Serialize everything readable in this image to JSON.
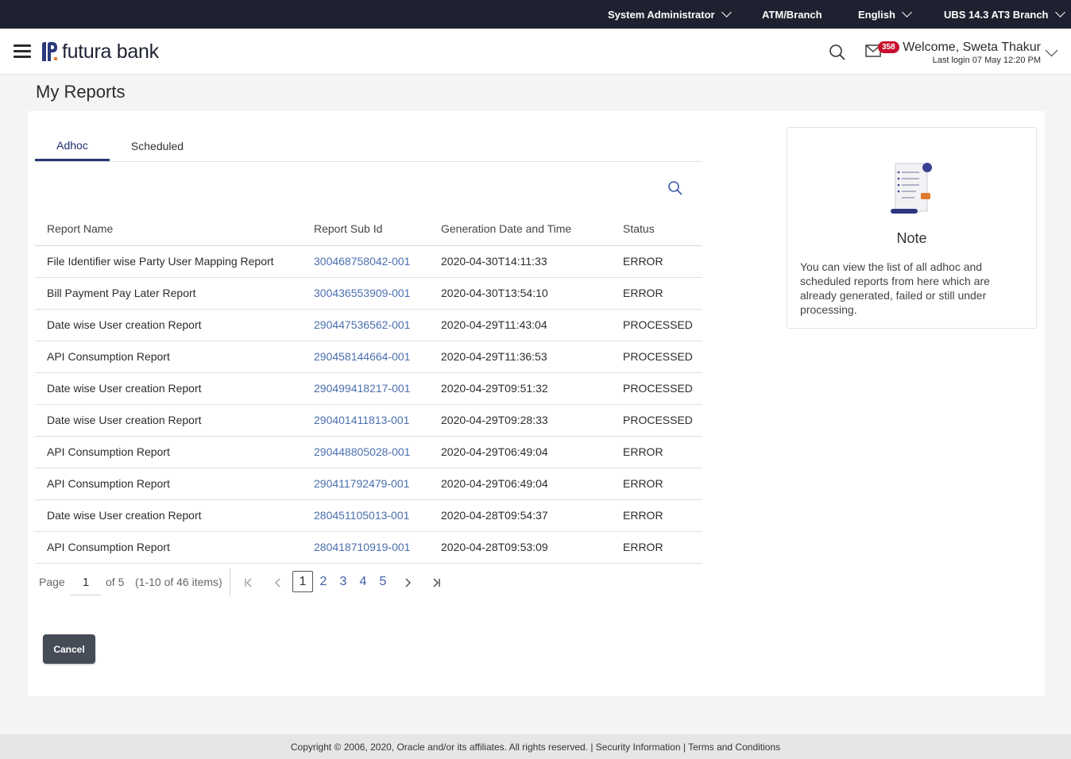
{
  "topbar": {
    "role": "System Administrator",
    "atm_branch": "ATM/Branch",
    "language": "English",
    "branch": "UBS 14.3 AT3 Branch"
  },
  "header": {
    "brand": "futura bank",
    "notification_count": "358",
    "welcome": "Welcome, Sweta Thakur",
    "last_login": "Last login 07 May 12:20 PM"
  },
  "page": {
    "title": "My Reports"
  },
  "tabs": [
    {
      "label": "Adhoc",
      "active": true
    },
    {
      "label": "Scheduled",
      "active": false
    }
  ],
  "table": {
    "columns": [
      "Report Name",
      "Report Sub Id",
      "Generation Date and Time",
      "Status"
    ],
    "rows": [
      {
        "name": "File Identifier wise Party User Mapping Report",
        "sub_id": "300468758042-001",
        "date": "2020-04-30T14:11:33",
        "status": "ERROR"
      },
      {
        "name": "Bill Payment Pay Later Report",
        "sub_id": "300436553909-001",
        "date": "2020-04-30T13:54:10",
        "status": "ERROR"
      },
      {
        "name": "Date wise User creation Report",
        "sub_id": "290447536562-001",
        "date": "2020-04-29T11:43:04",
        "status": "PROCESSED"
      },
      {
        "name": "API Consumption Report",
        "sub_id": "290458144664-001",
        "date": "2020-04-29T11:36:53",
        "status": "PROCESSED"
      },
      {
        "name": "Date wise User creation Report",
        "sub_id": "290499418217-001",
        "date": "2020-04-29T09:51:32",
        "status": "PROCESSED"
      },
      {
        "name": "Date wise User creation Report",
        "sub_id": "290401411813-001",
        "date": "2020-04-29T09:28:33",
        "status": "PROCESSED"
      },
      {
        "name": "API Consumption Report",
        "sub_id": "290448805028-001",
        "date": "2020-04-29T06:49:04",
        "status": "ERROR"
      },
      {
        "name": "API Consumption Report",
        "sub_id": "290411792479-001",
        "date": "2020-04-29T06:49:04",
        "status": "ERROR"
      },
      {
        "name": "Date wise User creation Report",
        "sub_id": "280451105013-001",
        "date": "2020-04-28T09:54:37",
        "status": "ERROR"
      },
      {
        "name": "API Consumption Report",
        "sub_id": "280418710919-001",
        "date": "2020-04-28T09:53:09",
        "status": "ERROR"
      }
    ]
  },
  "pagination": {
    "page_label": "Page",
    "current_page": "1",
    "of_label": "of 5",
    "items_label": "(1-10 of 46 items)",
    "pages": [
      "1",
      "2",
      "3",
      "4",
      "5"
    ]
  },
  "actions": {
    "cancel_label": "Cancel"
  },
  "note": {
    "title": "Note",
    "text": "You can view the list of all adhoc and scheduled reports from here which are already generated, failed or still under processing."
  },
  "footer": {
    "text": "Copyright © 2006, 2020, Oracle and/or its affiliates. All rights reserved. | Security Information | Terms and Conditions"
  },
  "colors": {
    "topbar_bg": "#1e2230",
    "brand_accent": "#273773",
    "link": "#4a6fb0",
    "badge": "#c8102e",
    "button_bg": "#454b57"
  }
}
